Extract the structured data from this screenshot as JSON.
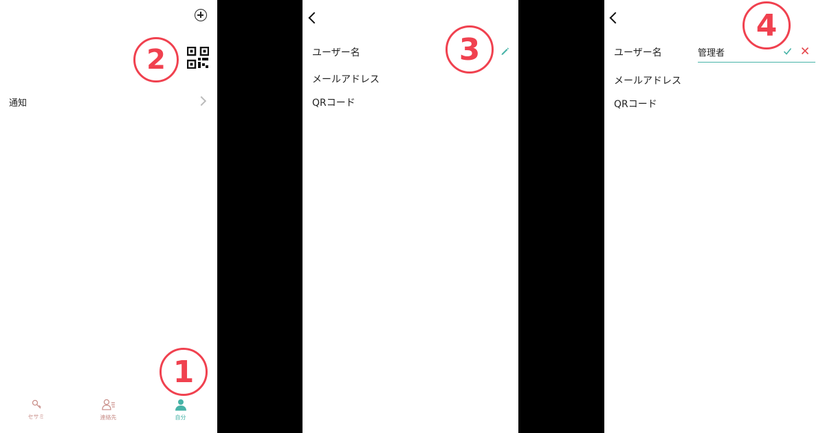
{
  "screen1": {
    "notifications_label": "通知",
    "tabs": [
      {
        "label": "セサミ",
        "icon": "key-icon"
      },
      {
        "label": "連絡先",
        "icon": "contacts-icon"
      },
      {
        "label": "自分",
        "icon": "person-icon"
      }
    ],
    "active_tab": "自分",
    "markers": {
      "tab": "1",
      "qr": "2"
    }
  },
  "screen2": {
    "username_label": "ユーザー名",
    "email_label": "メールアドレス",
    "qr_label": "QRコード",
    "marker": "3"
  },
  "screen3": {
    "username_label": "ユーザー名",
    "username_value": "管理者",
    "email_label": "メールアドレス",
    "qr_label": "QRコード",
    "marker": "4"
  },
  "colors": {
    "accent": "#47b3a7",
    "marker": "#f0414f",
    "inactive_tab": "#c98f8a",
    "cancel": "#e5484d"
  }
}
